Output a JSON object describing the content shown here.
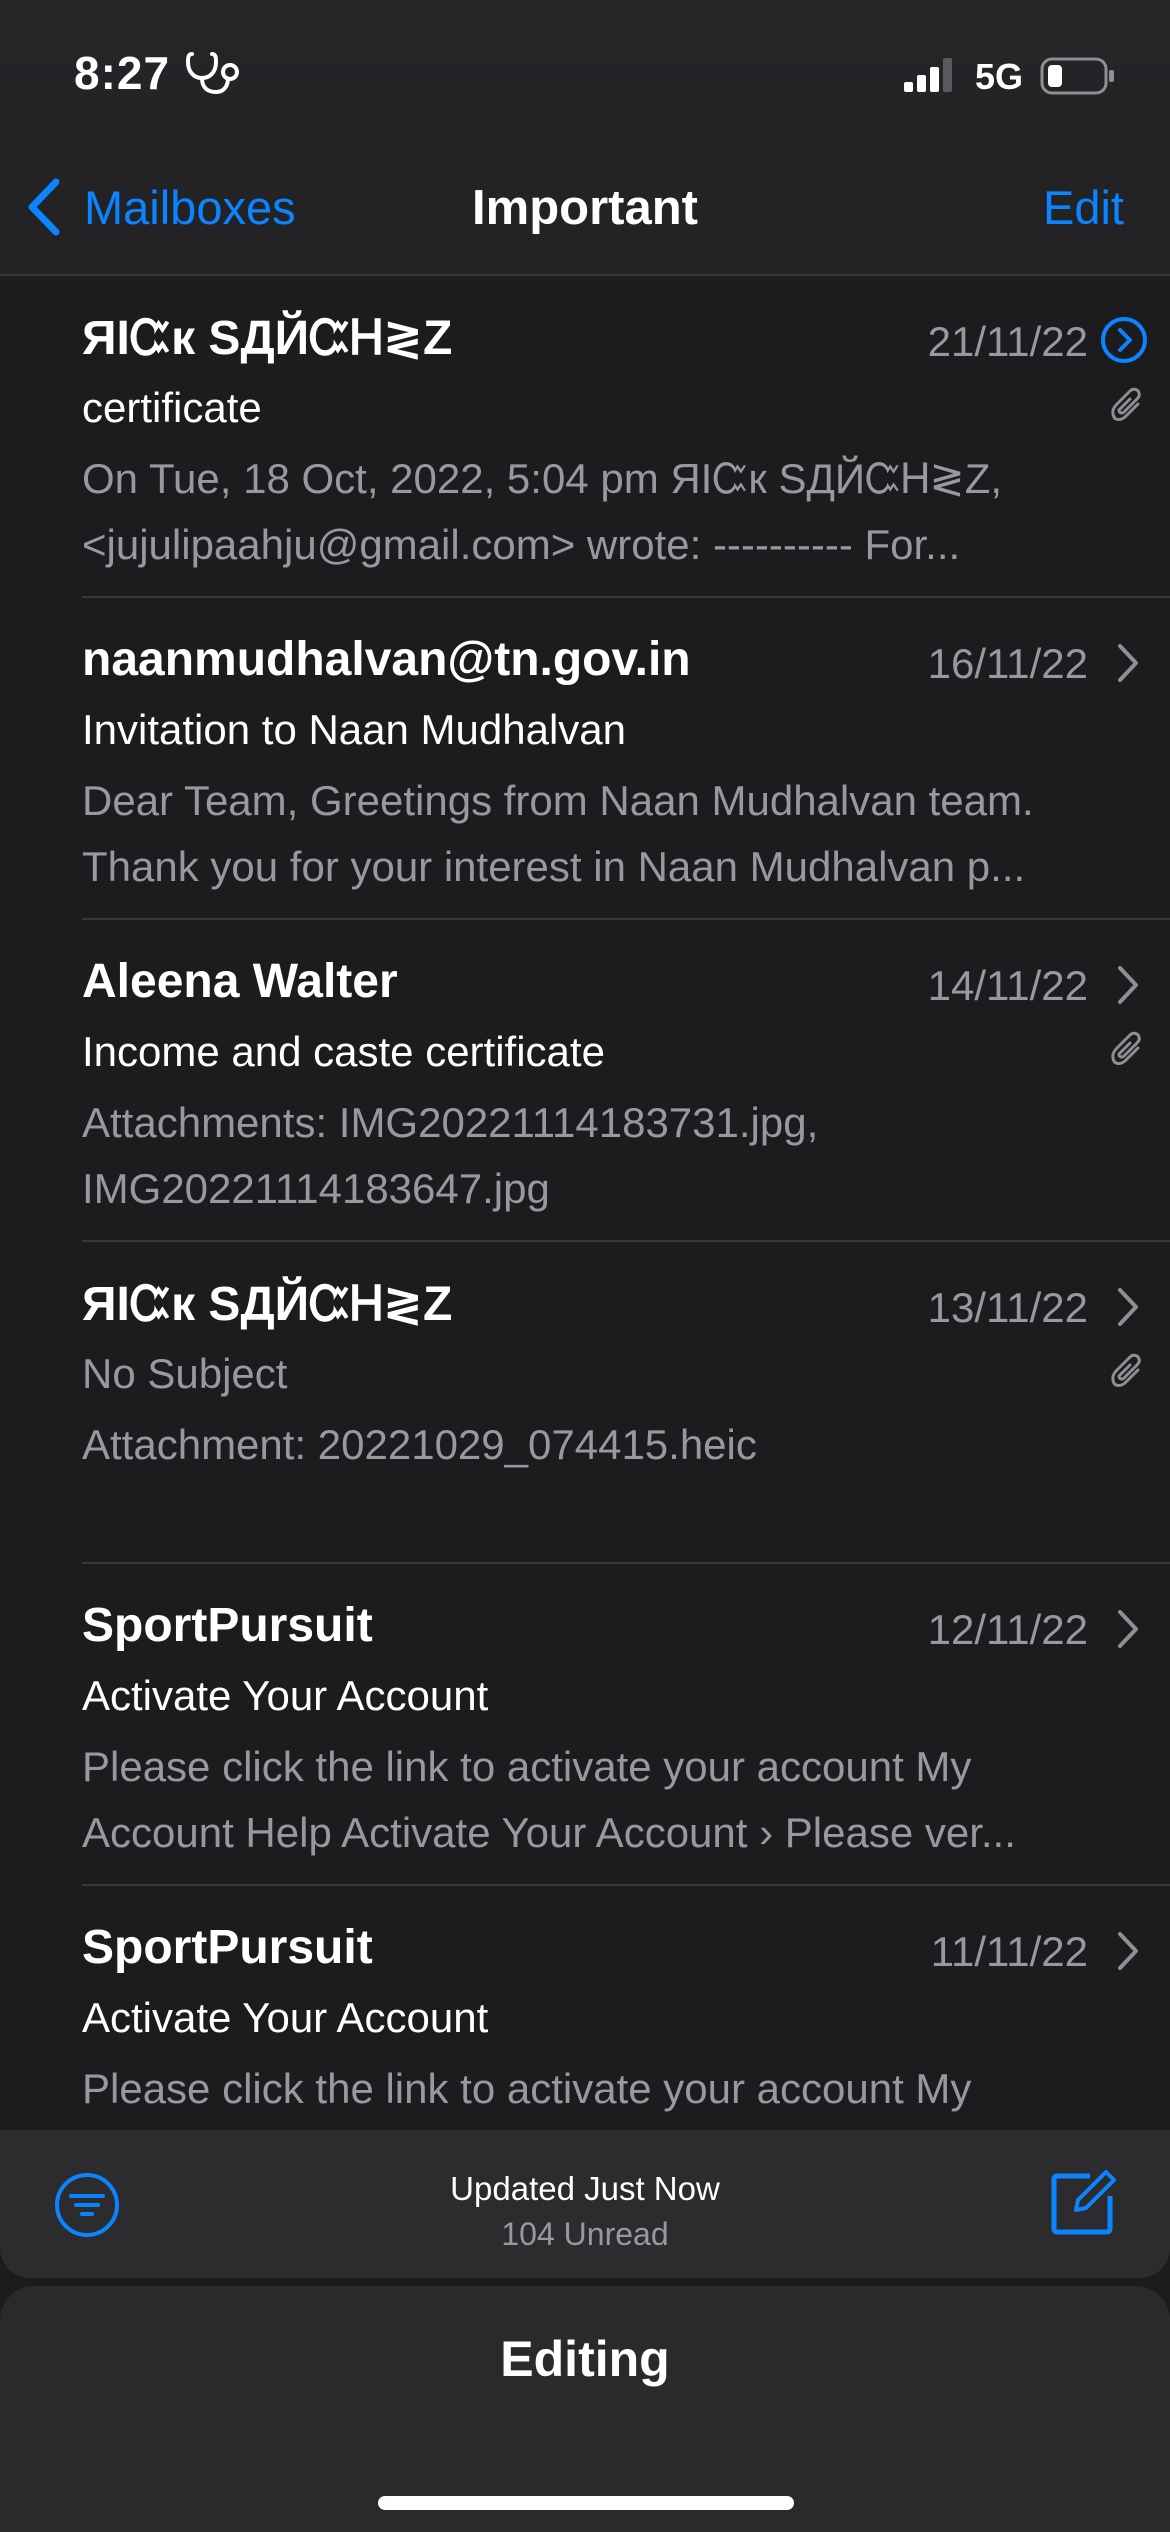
{
  "status": {
    "time": "8:27",
    "network": "5G"
  },
  "nav": {
    "back_label": "Mailboxes",
    "title": "Important",
    "edit_label": "Edit"
  },
  "messages": [
    {
      "sender": "ЯІᏨк SДЙᏨᎻ≷Z",
      "date": "21/11/22",
      "subject": "certificate",
      "preview": "On Tue, 18 Oct, 2022, 5:04 pm ЯІᏨк SДЙᏨᎻ≷Z, <jujulipaahju@gmail.com> wrote: ---------- For...",
      "attachment": true
    },
    {
      "sender": "naanmudhalvan@tn.gov.in",
      "date": "16/11/22",
      "subject": "Invitation to Naan Mudhalvan",
      "preview": "Dear Team, Greetings from Naan Mudhalvan team. Thank you for your interest in Naan Mudhalvan p...",
      "attachment": false
    },
    {
      "sender": "Aleena Walter",
      "date": "14/11/22",
      "subject": "Income and caste certificate",
      "preview": "Attachments: IMG20221114183731.jpg, IMG20221114183647.jpg",
      "attachment": true
    },
    {
      "sender": "ЯІᏨк SДЙᏨᎻ≷Z",
      "date": "13/11/22",
      "subject": "No Subject",
      "preview": "Attachment: 20221029_074415.heic",
      "attachment": true
    },
    {
      "sender": "SportPursuit",
      "date": "12/11/22",
      "subject": "Activate Your Account",
      "preview": "Please click the link to activate your account My Account Help Activate Your Account › Please ver...",
      "attachment": false
    },
    {
      "sender": "SportPursuit",
      "date": "11/11/22",
      "subject": "Activate Your Account",
      "preview": "Please click the link to activate your account My",
      "attachment": false
    }
  ],
  "toolbar": {
    "updated": "Updated Just Now",
    "unread": "104 Unread"
  },
  "editing": {
    "title": "Editing"
  },
  "colors": {
    "accent": "#0a84ff",
    "background": "#1c1c1e",
    "secondary_text": "#98989f"
  }
}
